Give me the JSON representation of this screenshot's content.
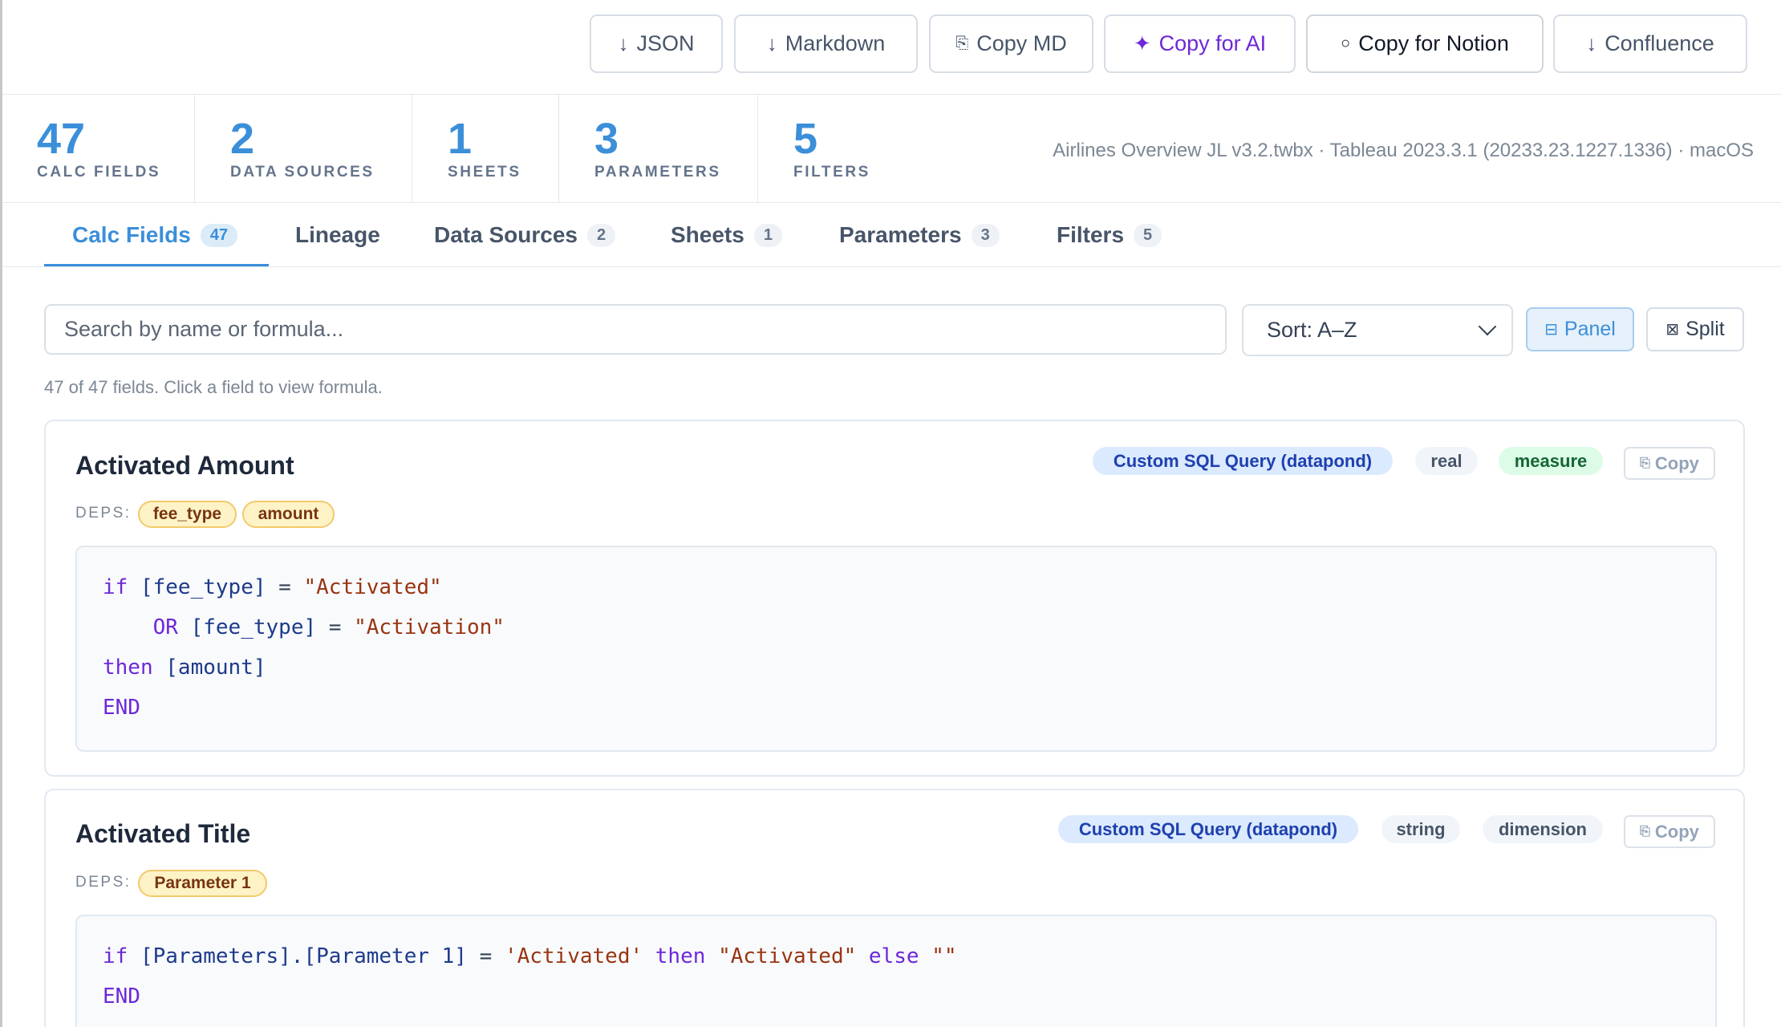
{
  "toolbar": {
    "json": {
      "icon": "↓",
      "label": "JSON"
    },
    "markdown": {
      "icon": "↓",
      "label": "Markdown"
    },
    "copy_md": {
      "icon": "⎘",
      "label": "Copy MD"
    },
    "copy_ai": {
      "icon": "✦",
      "label": "Copy for AI"
    },
    "copy_notion": {
      "icon": "○",
      "label": "Copy for Notion"
    },
    "confluence": {
      "icon": "↓",
      "label": "Confluence"
    }
  },
  "stats": [
    {
      "value": "47",
      "label": "CALC FIELDS"
    },
    {
      "value": "2",
      "label": "DATA SOURCES"
    },
    {
      "value": "1",
      "label": "SHEETS"
    },
    {
      "value": "3",
      "label": "PARAMETERS"
    },
    {
      "value": "5",
      "label": "FILTERS"
    }
  ],
  "meta": "Airlines Overview JL v3.2.twbx · Tableau 2023.3.1 (20233.23.1227.1336) · macOS",
  "tabs": [
    {
      "label": "Calc Fields",
      "count": "47",
      "active": true
    },
    {
      "label": "Lineage",
      "count": null
    },
    {
      "label": "Data Sources",
      "count": "2"
    },
    {
      "label": "Sheets",
      "count": "1"
    },
    {
      "label": "Parameters",
      "count": "3"
    },
    {
      "label": "Filters",
      "count": "5"
    }
  ],
  "search": {
    "placeholder": "Search by name or formula..."
  },
  "sort": {
    "value": "Sort: A–Z"
  },
  "view": {
    "panel": {
      "icon": "⊟",
      "label": "Panel"
    },
    "split": {
      "icon": "⊠",
      "label": "Split"
    }
  },
  "hint": "47 of 47 fields. Click a field to view formula.",
  "cards": [
    {
      "title": "Activated Amount",
      "source": "Custom SQL Query (datapond)",
      "datatype": "real",
      "role": "measure",
      "copy": {
        "icon": "⎘",
        "label": "Copy"
      },
      "deps_label": "DEPS:",
      "deps": [
        "fee_type",
        "amount"
      ],
      "formula": [
        [
          [
            "kw",
            "if"
          ],
          [
            "op",
            " "
          ],
          [
            "fld",
            "[fee_type]"
          ],
          [
            "op",
            " = "
          ],
          [
            "str",
            "\"Activated\""
          ]
        ],
        [
          [
            "op",
            "    "
          ],
          [
            "kw",
            "OR"
          ],
          [
            "op",
            " "
          ],
          [
            "fld",
            "[fee_type]"
          ],
          [
            "op",
            " = "
          ],
          [
            "str",
            "\"Activation\""
          ]
        ],
        [
          [
            "kw",
            "then"
          ],
          [
            "op",
            " "
          ],
          [
            "fld",
            "[amount]"
          ]
        ],
        [
          [
            "kw",
            "END"
          ]
        ]
      ]
    },
    {
      "title": "Activated Title",
      "source": "Custom SQL Query (datapond)",
      "datatype": "string",
      "role": "dimension",
      "copy": {
        "icon": "⎘",
        "label": "Copy"
      },
      "deps_label": "DEPS:",
      "deps": [
        "Parameter 1"
      ],
      "formula": [
        [
          [
            "kw",
            "if"
          ],
          [
            "op",
            " "
          ],
          [
            "fld",
            "[Parameters].[Parameter 1]"
          ],
          [
            "op",
            " = "
          ],
          [
            "str",
            "'Activated'"
          ],
          [
            "op",
            " "
          ],
          [
            "kw",
            "then"
          ],
          [
            "op",
            " "
          ],
          [
            "str",
            "\"Activated\""
          ],
          [
            "op",
            " "
          ],
          [
            "kw",
            "else"
          ],
          [
            "op",
            " "
          ],
          [
            "str",
            "\"\""
          ]
        ],
        [
          [
            "kw",
            "END"
          ]
        ]
      ]
    }
  ]
}
